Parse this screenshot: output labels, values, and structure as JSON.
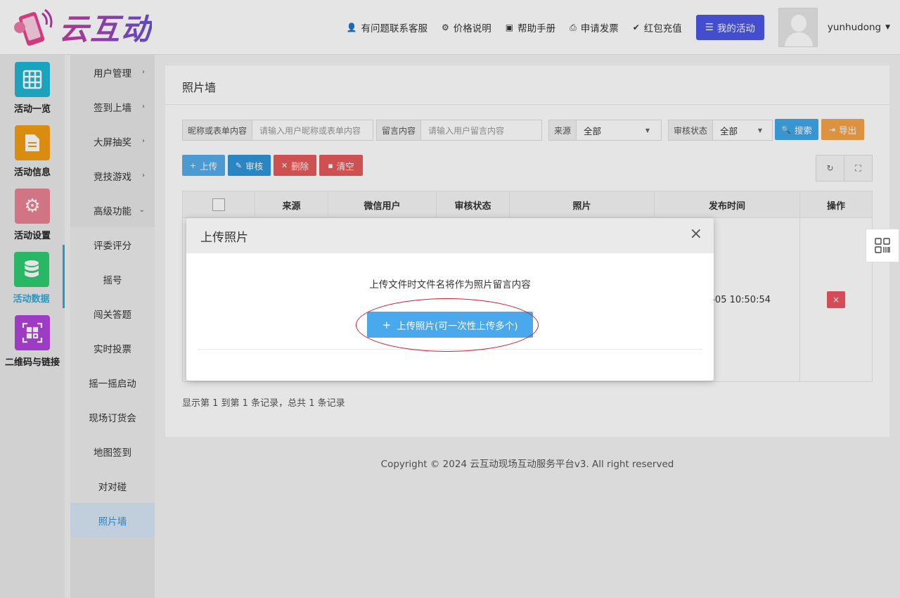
{
  "header": {
    "brand": "云互动",
    "nav": [
      {
        "icon": "user-plus-icon",
        "glyph": "👤",
        "label": "有问题联系客服"
      },
      {
        "icon": "gear-icon",
        "glyph": "⚙",
        "label": "价格说明"
      },
      {
        "icon": "book-icon",
        "glyph": "▣",
        "label": "帮助手册"
      },
      {
        "icon": "printer-icon",
        "glyph": "⎙",
        "label": "申请发票"
      },
      {
        "icon": "shield-check-icon",
        "glyph": "✔",
        "label": "红包充值"
      }
    ],
    "my_activity": "我的活动",
    "username": "yunhudong"
  },
  "icon_sidebar": [
    {
      "label": "活动一览",
      "icon": "grid-icon",
      "color": "#1fb5d3"
    },
    {
      "label": "活动信息",
      "icon": "document-icon",
      "color": "#f39c12"
    },
    {
      "label": "活动设置",
      "icon": "gear-icon",
      "color": "#e98394"
    },
    {
      "label": "活动数据",
      "icon": "database-icon",
      "color": "#2ecc71",
      "active": true
    },
    {
      "label": "二维码与链接",
      "icon": "qrcode-icon",
      "color": "#b042dc"
    }
  ],
  "menu": [
    {
      "label": "用户管理",
      "arrow": "›"
    },
    {
      "label": "签到上墙",
      "arrow": "›"
    },
    {
      "label": "大屏抽奖",
      "arrow": "›"
    },
    {
      "label": "竞技游戏",
      "arrow": "›"
    },
    {
      "label": "高级功能",
      "arrow": "⌄"
    },
    {
      "label": "评委评分"
    },
    {
      "label": "摇号"
    },
    {
      "label": "闯关答题"
    },
    {
      "label": "实时投票"
    },
    {
      "label": "摇一摇启动"
    },
    {
      "label": "现场订货会"
    },
    {
      "label": "地图签到"
    },
    {
      "label": "对对碰"
    },
    {
      "label": "照片墙",
      "active": true
    }
  ],
  "panel": {
    "title": "照片墙",
    "filters": {
      "nickname_label": "昵称或表单内容",
      "nickname_placeholder": "请输入用户昵称或表单内容",
      "message_label": "留言内容",
      "message_placeholder": "请输入用户留言内容",
      "source_label": "来源",
      "source_value": "全部",
      "status_label": "审核状态",
      "status_value": "全部",
      "search": "搜索",
      "export": "导出"
    },
    "actions": {
      "upload": "上传",
      "review": "审核",
      "delete": "删除",
      "clear": "清空"
    },
    "table": {
      "columns": [
        "",
        "来源",
        "微信用户",
        "审核状态",
        "照片",
        "发布时间",
        "操作"
      ],
      "rows": [
        {
          "time_visible": "1-05 10:50:54",
          "action": "×"
        }
      ]
    },
    "records": "显示第 1 到第 1 条记录，总共 1 条记录"
  },
  "footer": "Copyright © 2024 云互动现场互动服务平台v3. All right reserved",
  "modal": {
    "title": "上传照片",
    "close": "×",
    "hint": "上传文件时文件名将作为照片留言内容",
    "upload_button": "上传照片(可一次性上传多个)",
    "upload_plus": "+"
  }
}
